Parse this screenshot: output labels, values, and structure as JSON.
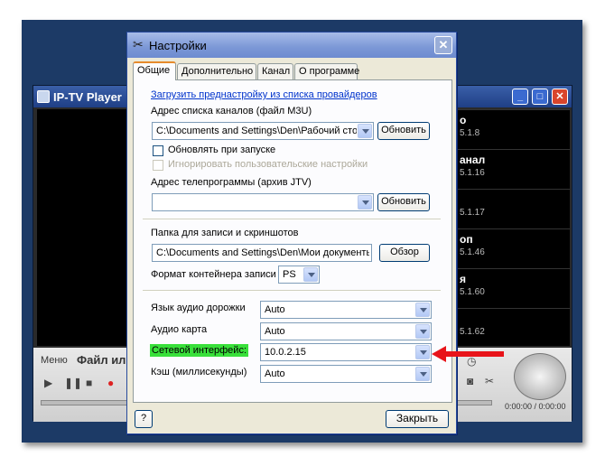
{
  "player": {
    "title": "IP-TV Player",
    "menu": "Меню",
    "file_label": "Файл или",
    "channels": [
      {
        "name": "о",
        "addr": "5.1.8"
      },
      {
        "name": "анал",
        "addr": "5.1.16"
      },
      {
        "name": "",
        "addr": "5.1.17"
      },
      {
        "name": "оп",
        "addr": "5.1.46"
      },
      {
        "name": "я",
        "addr": "5.1.60"
      },
      {
        "name": "",
        "addr": "5.1.62"
      }
    ],
    "time": "0:00:00 / 0:00:00"
  },
  "dialog": {
    "title": "Настройки",
    "help_button": "?",
    "close_button": "Закрыть",
    "tabs": [
      {
        "label": "Общие",
        "active": true
      },
      {
        "label": "Дополнительно"
      },
      {
        "label": "Канал"
      },
      {
        "label": "О программе"
      }
    ],
    "general": {
      "preset_link": "Загрузить преднастройку из списка провайдеров",
      "channels_label": "Адрес списка каналов (файл M3U)",
      "channels_value": "C:\\Documents and Settings\\Den\\Рабочий стол\\i",
      "refresh_button": "Обновить",
      "update_on_start": "Обновлять при запуске",
      "ignore_user": "Игнорировать пользовательские настройки",
      "tvguide_label": "Адрес телепрограммы (архив JTV)",
      "tvguide_value": "",
      "refresh_button2": "Обновить",
      "record_folder_label": "Папка для записи и скриншотов",
      "record_folder_value": "C:\\Documents and Settings\\Den\\Мои документы\\",
      "browse_button": "Обзор",
      "container_label": "Формат контейнера записи",
      "container_value": "PS",
      "audio_track_label": "Язык аудио дорожки",
      "audio_track_value": "Auto",
      "audio_card_label": "Аудио карта",
      "audio_card_value": "Auto",
      "network_label": "Сетевой интерфейс:",
      "network_value": "10.0.2.15",
      "cache_label": "Кэш (миллисекунды)",
      "cache_value": "Auto"
    }
  },
  "colors": {
    "highlight": "#39e03a",
    "arrow": "#e8141a"
  }
}
